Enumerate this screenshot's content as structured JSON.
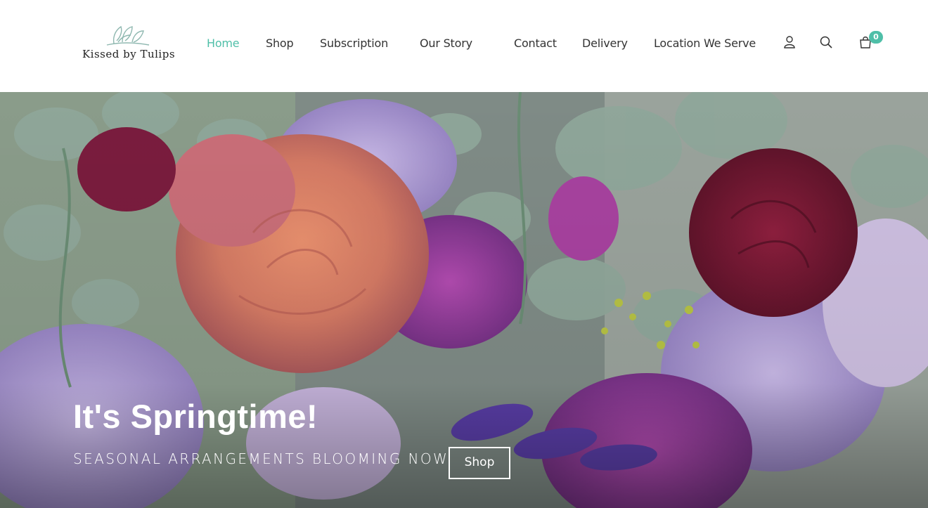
{
  "brand": {
    "name": "Kissed by Tulips"
  },
  "nav": {
    "home": "Home",
    "shop": "Shop",
    "subscription": "Subscription",
    "our_story": "Our Story",
    "contact": "Contact",
    "delivery": "Delivery",
    "location": "Location We Serve"
  },
  "cart": {
    "count": "0"
  },
  "hero": {
    "title": "It's Springtime!",
    "subtitle": "SEASONAL ARRANGEMENTS BLOOMING NOW",
    "button": "Shop"
  },
  "colors": {
    "accent": "#4fbfa8",
    "text": "#333333"
  }
}
